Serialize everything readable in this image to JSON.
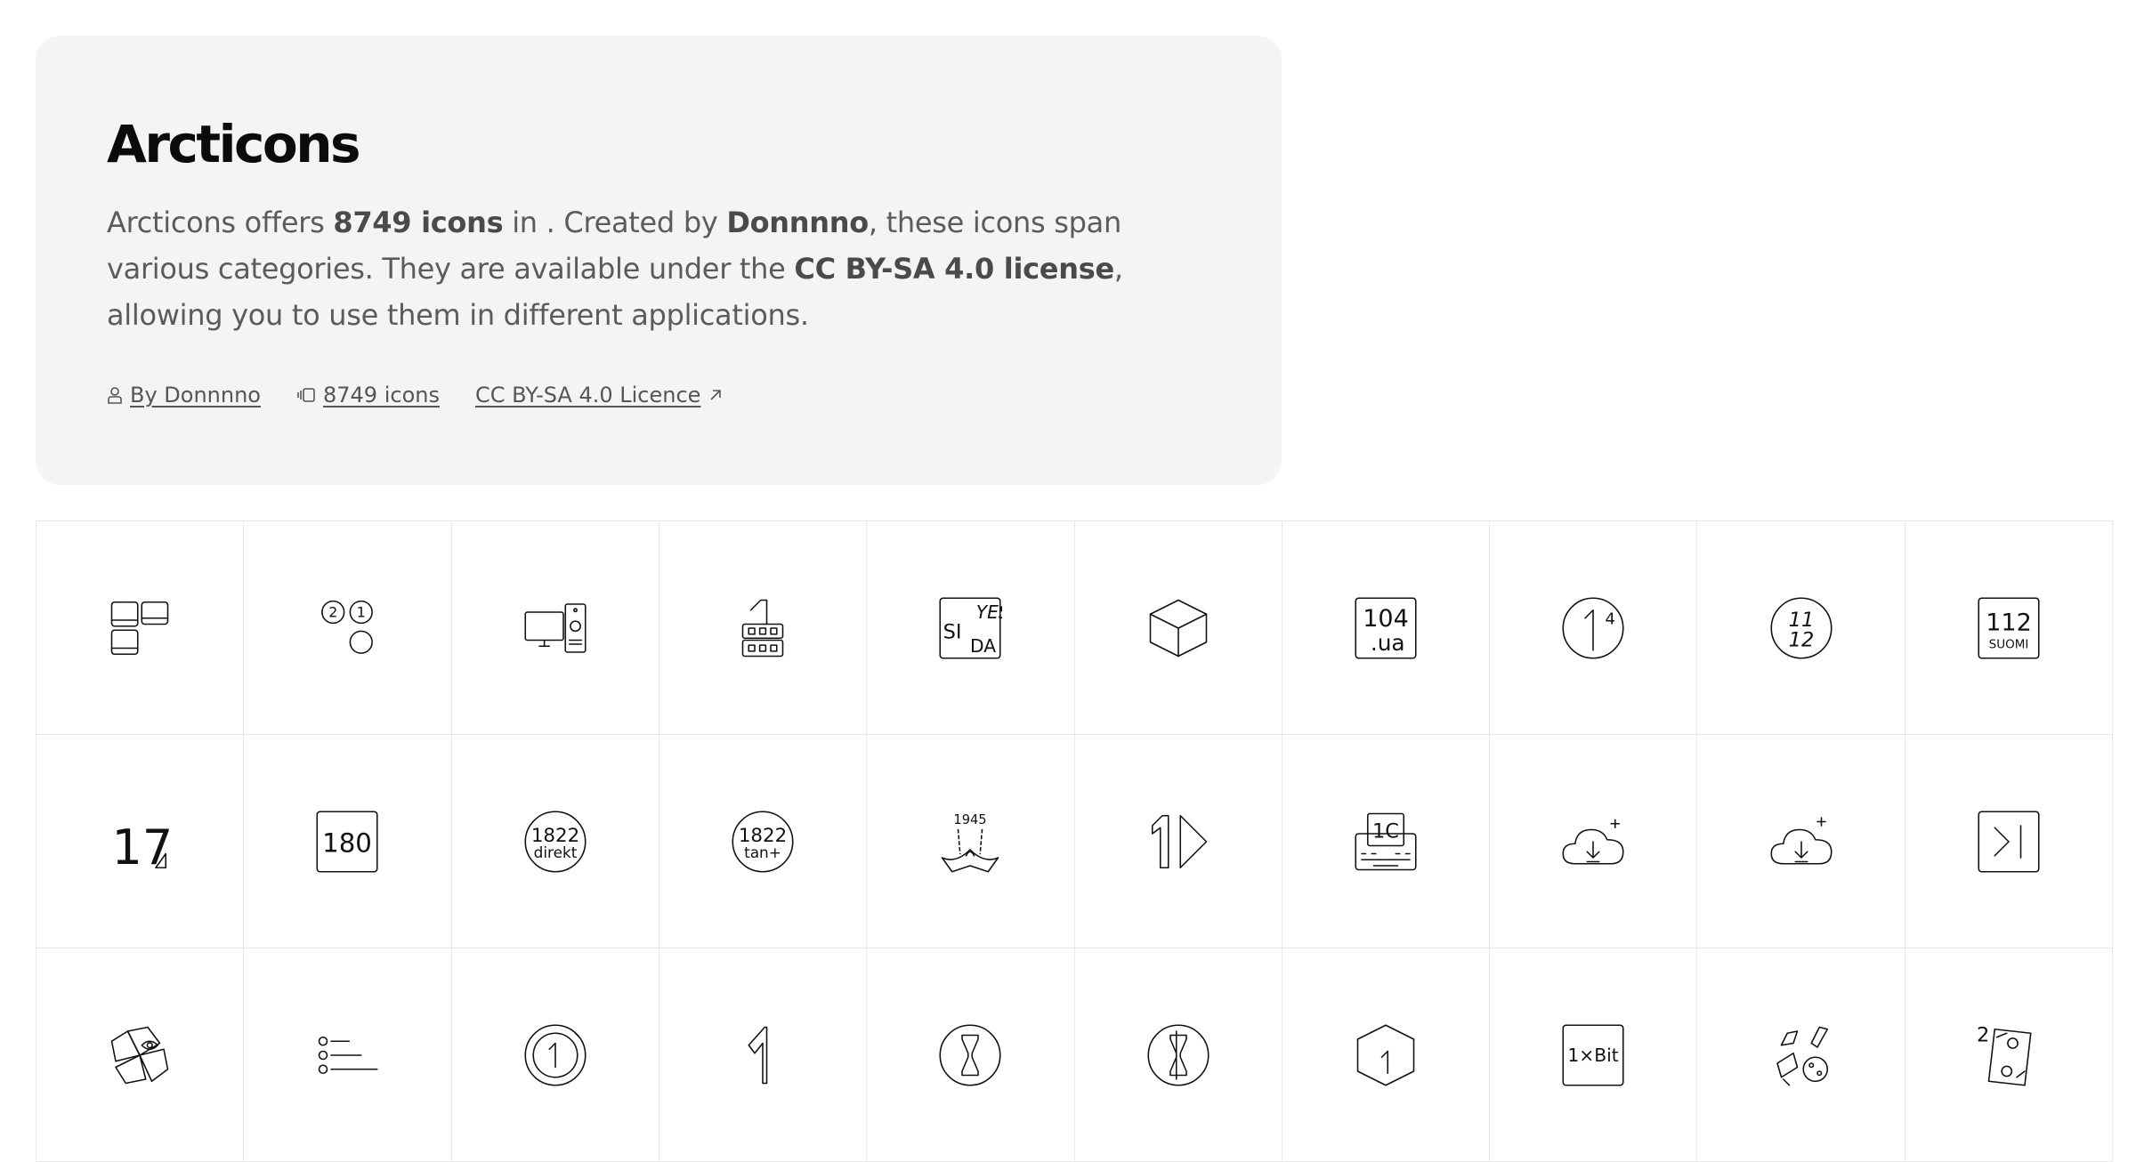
{
  "header": {
    "title": "Arcticons",
    "desc_p1": "Arcticons offers ",
    "desc_count": "8749 icons",
    "desc_p2": " in . Created by ",
    "desc_author": "Donnnno",
    "desc_p3": ", these icons span various categories. They are available under the ",
    "desc_license": "CC BY-SA 4.0 license",
    "desc_p4": ", allowing you to use them in different applications."
  },
  "meta": {
    "author_label": "By Donnnno",
    "count_label": "8749 icons",
    "license_label": "CC BY-SA 4.0 Licence"
  },
  "icon_texts": {
    "yes": "YES",
    "si": "SI",
    "da": "DA",
    "n104": "104",
    "ua": ".ua",
    "n1": "1",
    "n4": "4",
    "n11": "11",
    "n12": "12",
    "n112": "112",
    "suomi": "SUOMI",
    "n17": "17",
    "n180": "180",
    "n1822": "1822",
    "direkt": "direkt",
    "tan": "tan+",
    "n1945": "1945",
    "n1c": "1C",
    "onexbit": "1×Bit",
    "n2": "2"
  },
  "icons": [
    "1-tiles-icon",
    "21-circles-icon",
    "1-pc-tower-icon",
    "1-film-icon",
    "yes-si-da-icon",
    "cube-icon",
    "104-ua-icon",
    "1-4-circle-icon",
    "11-12-circle-icon",
    "112-suomi-icon",
    "17-icon",
    "180-icon",
    "1822-direkt-icon",
    "1822-tanplus-icon",
    "1945-icon",
    "1-play-icon",
    "1c-keyboard-icon",
    "cloud-download-plus-icon",
    "cloud-download-plus-alt-icon",
    "skip-end-icon",
    "pinwheel-eye-icon",
    "bullet-list-icon",
    "1-ring-icon",
    "arrow-one-icon",
    "hourglass-circle-icon",
    "hourglass-circle-alt-icon",
    "hexagon-1-icon",
    "1xbit-icon",
    "rocket-planet-icon",
    "2-phone-icon"
  ]
}
